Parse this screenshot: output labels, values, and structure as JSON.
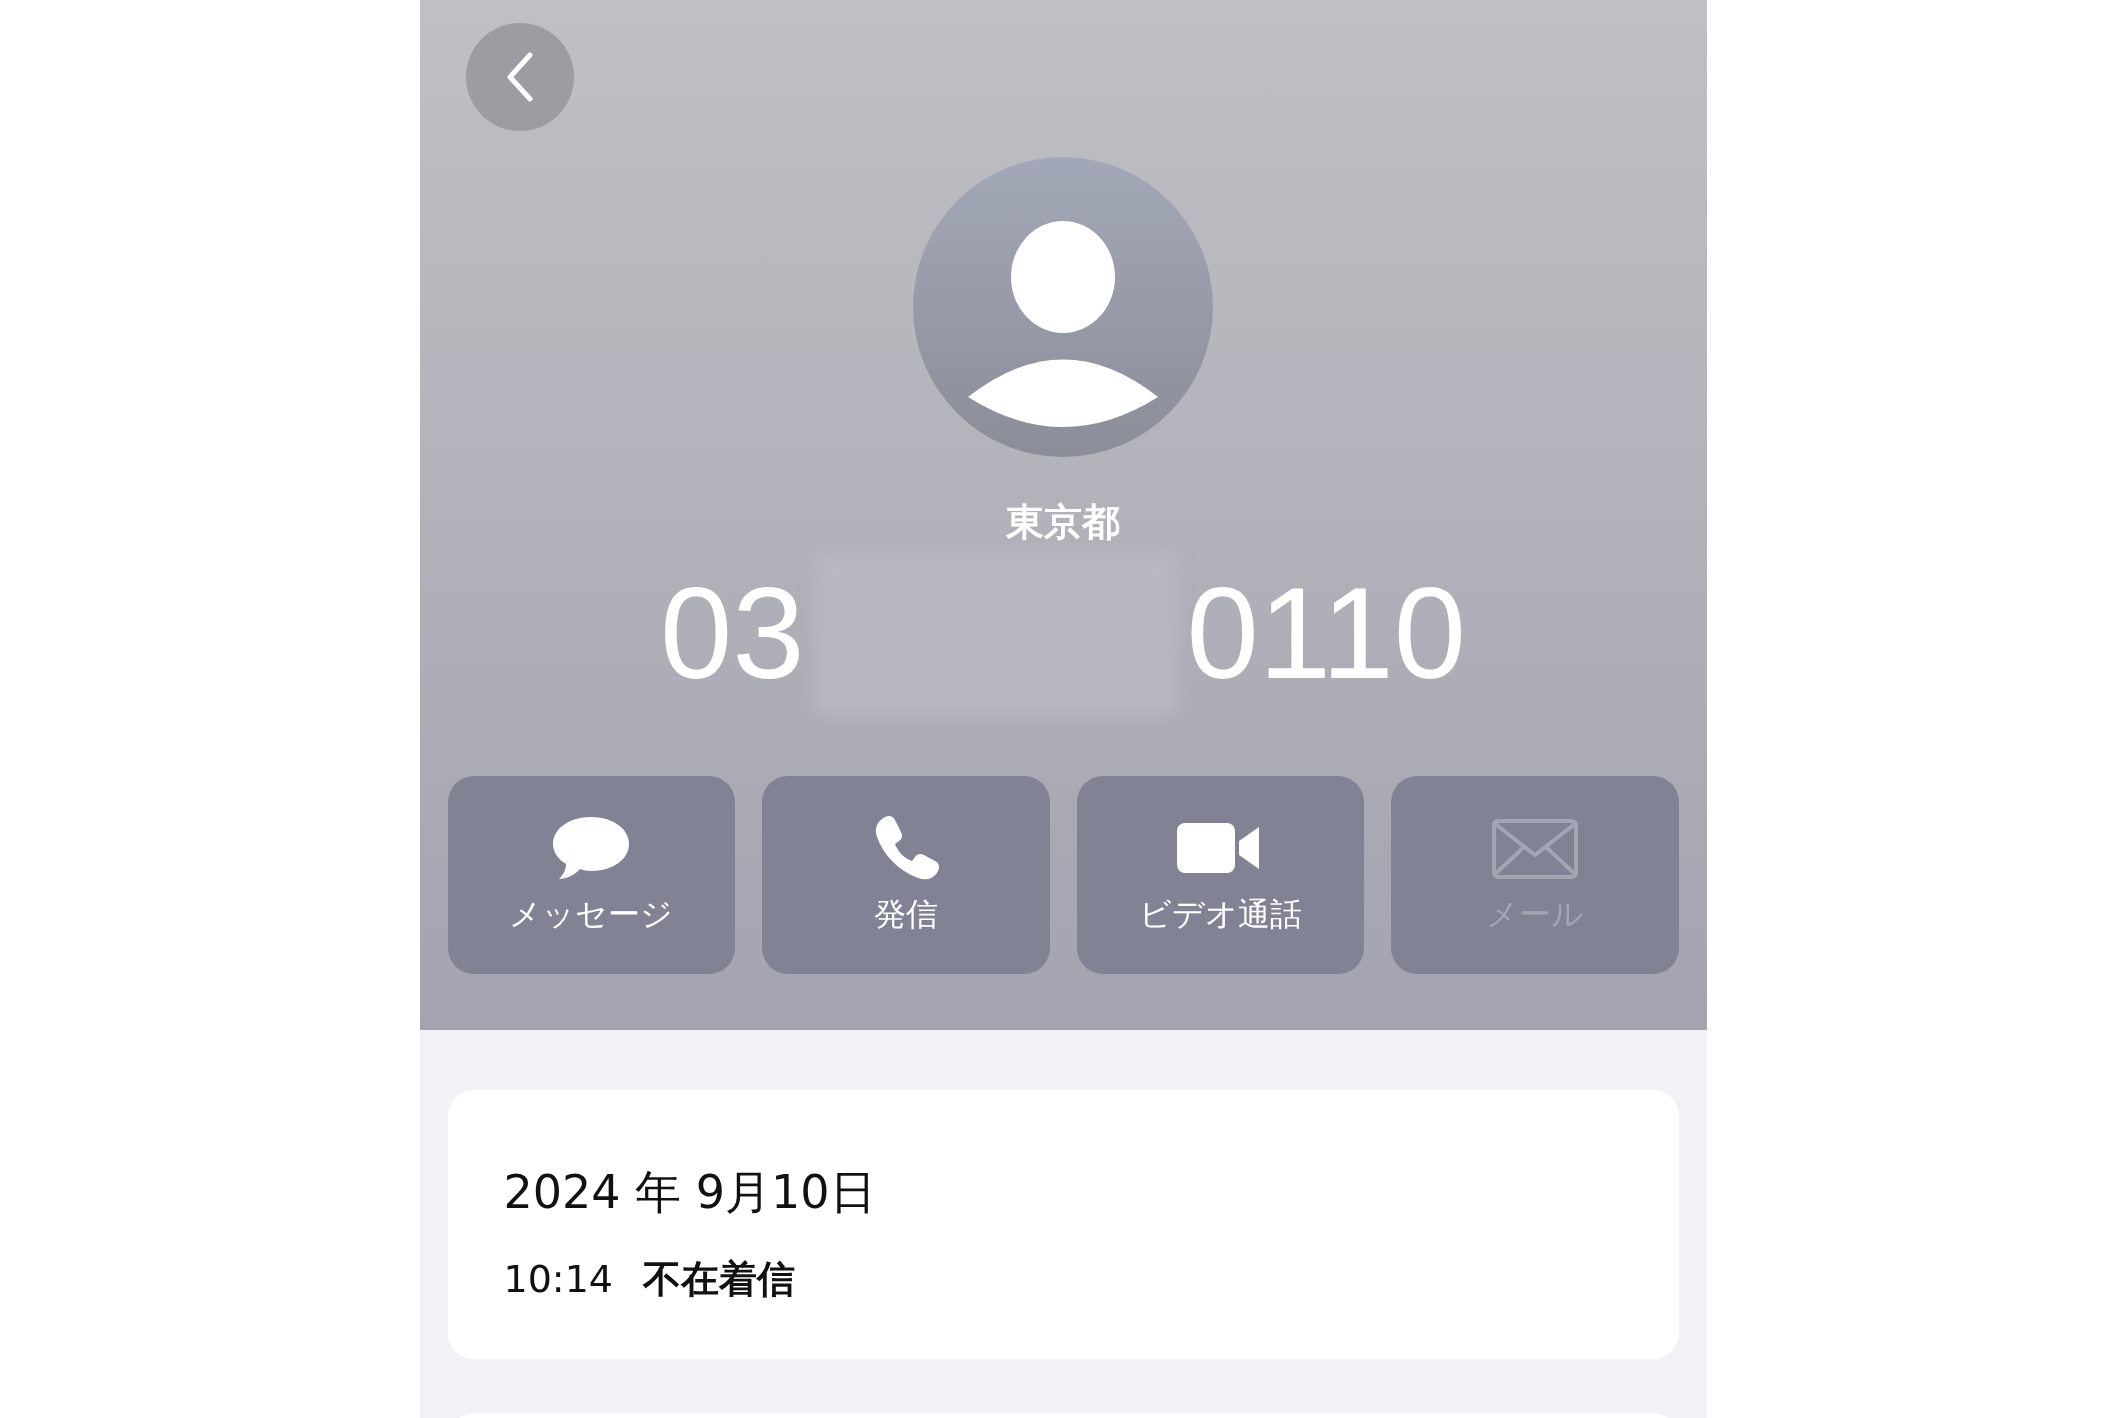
{
  "header": {
    "location": "東京都",
    "number_parts": [
      "03",
      "0110"
    ],
    "redacted": true
  },
  "actions": [
    {
      "kind": "message",
      "label": "メッセージ",
      "disabled": false
    },
    {
      "kind": "call",
      "label": "発信",
      "disabled": false
    },
    {
      "kind": "video",
      "label": "ビデオ通話",
      "disabled": false
    },
    {
      "kind": "mail",
      "label": "メール",
      "disabled": true
    }
  ],
  "history": {
    "date": "2024 年 9月10日",
    "entries": [
      {
        "time": "10:14",
        "type": "不在着信"
      }
    ]
  }
}
